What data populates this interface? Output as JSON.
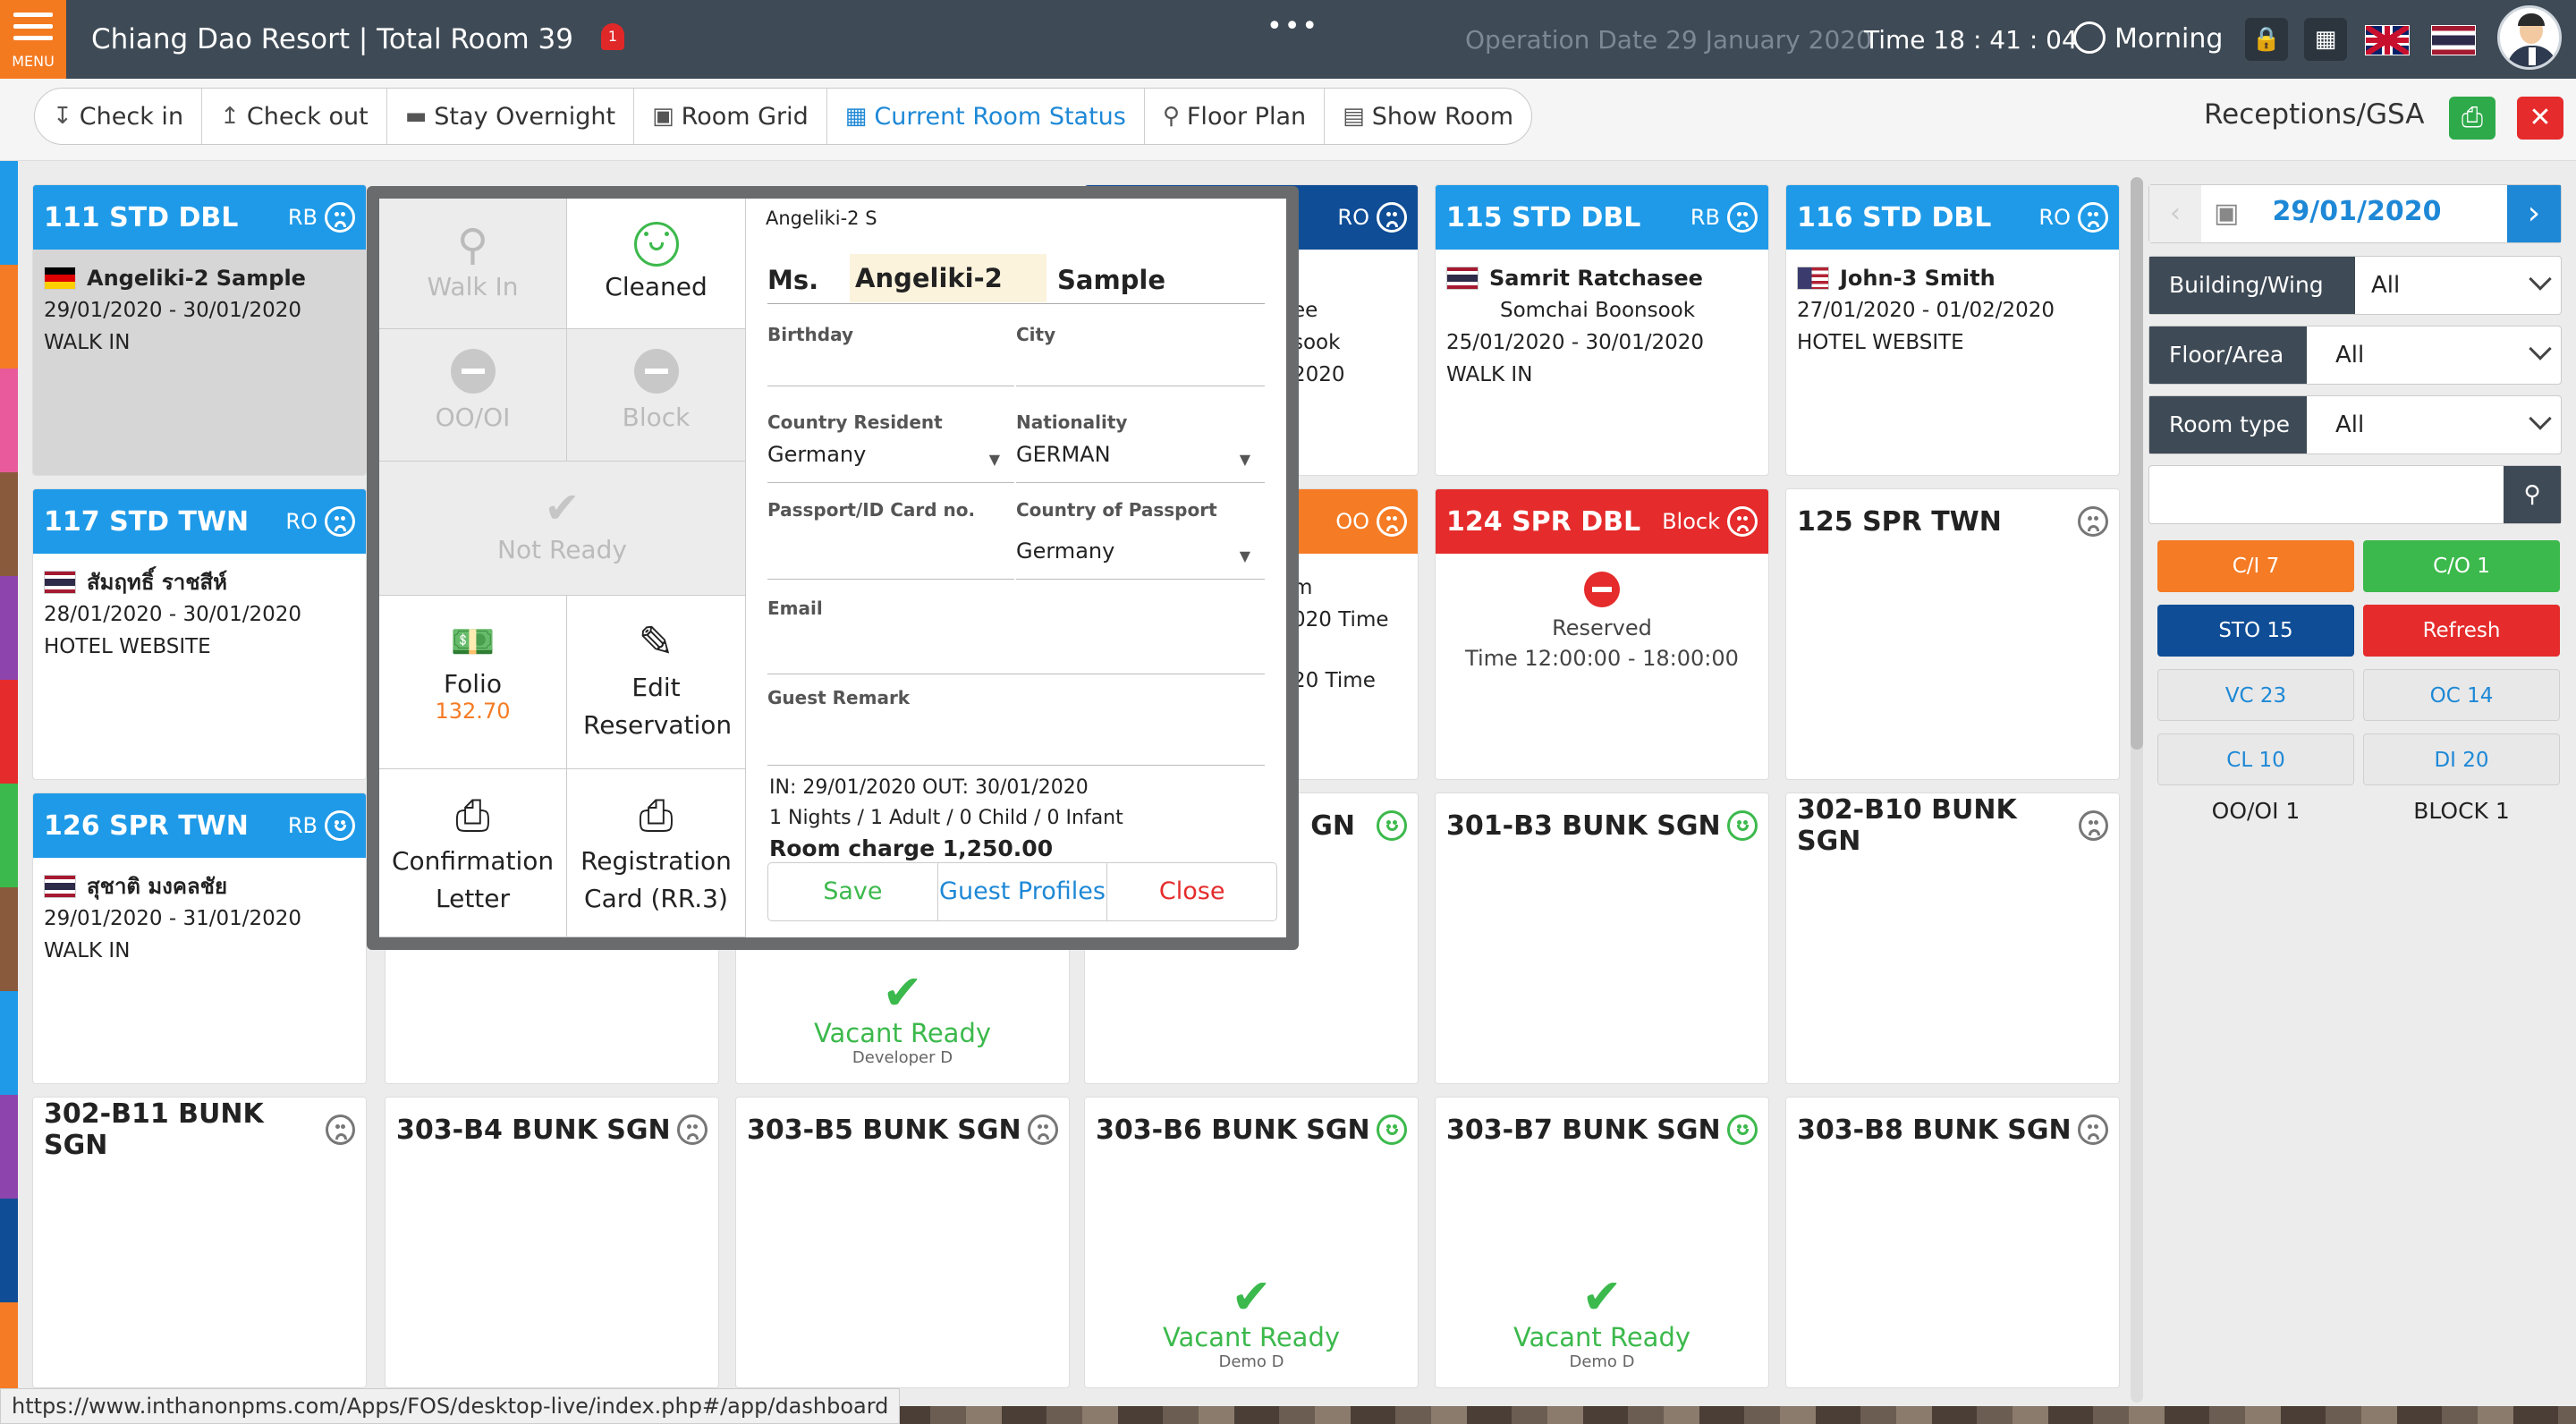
{
  "topbar": {
    "menu_label": "MENU",
    "title": "Chiang Dao Resort | Total Room 39",
    "notification_count": "1",
    "more": "•••",
    "operation_date": "Operation Date 29 January 2020",
    "time": "Time 18 : 41 : 04",
    "shift": "Morning"
  },
  "nav": {
    "tabs": [
      "Check in",
      "Check out",
      "Stay Overnight",
      "Room Grid",
      "Current Room Status",
      "Floor Plan",
      "Show Room"
    ],
    "active_tab": "Current Room Status",
    "receptions_title": "Receptions/GSA"
  },
  "rooms": [
    {
      "title": "111 STD DBL",
      "board": "RB",
      "guest": "Angeliki-2 Sample",
      "dates": "29/01/2020 - 30/01/2020",
      "source": "WALK IN"
    },
    {
      "title": "115 STD DBL",
      "board": "RB",
      "guest": "Samrit Ratchasee",
      "guest2": "Somchai Boonsook",
      "dates": "25/01/2020 - 30/01/2020",
      "source": "WALK IN"
    },
    {
      "title": "116 STD DBL",
      "board": "RO",
      "guest": "John-3 Smith",
      "dates": "27/01/2020 - 01/02/2020",
      "source": "HOTEL WEBSITE"
    },
    {
      "title": "117 STD TWN",
      "board": "RO",
      "guest": "สัมฤทธิ์ ราชสีห์",
      "dates": "28/01/2020 - 30/01/2020",
      "source": "HOTEL WEBSITE"
    },
    {
      "title": "124 SPR DBL",
      "board": "Block",
      "reserved": "Reserved",
      "time": "Time 12:00:00 - 18:00:00"
    },
    {
      "title": "125 SPR TWN"
    },
    {
      "title": "126 SPR TWN",
      "board": "RB",
      "guest": "สุชาติ มงคลชัย",
      "dates": "29/01/2020 - 31/01/2020",
      "source": "WALK IN"
    },
    {
      "title": "301-B3 BUNK SGN"
    },
    {
      "title": "302-B10 BUNK SGN"
    },
    {
      "title": "302-B11 BUNK SGN"
    },
    {
      "title": "303-B4 BUNK SGN"
    },
    {
      "title": "303-B5 BUNK SGN"
    },
    {
      "title": "303-B6 BUNK SGN",
      "status": "Vacant Ready",
      "by": "Demo D"
    },
    {
      "title": "303-B7 BUNK SGN",
      "status": "Vacant Ready",
      "by": "Demo D"
    },
    {
      "title": "303-B8 BUNK SGN"
    }
  ],
  "partial": {
    "ro_label": "RO",
    "oo_label": "OO",
    "frag1": "ee",
    "frag2": "sook",
    "frag3": "2020",
    "frag4": "m",
    "frag5": "020 Time",
    "frag6": "20 Time",
    "frag7": "GN",
    "vacant_status": "Vacant Ready",
    "vacant_by": "Developer D"
  },
  "popup": {
    "walk_in": "Walk In",
    "cleaned": "Cleaned",
    "oo_oi": "OO/OI",
    "block": "Block",
    "not_ready": "Not Ready",
    "folio": "Folio",
    "folio_amount": "132.70",
    "edit_reservation": "Edit Reservation",
    "confirmation_letter": "Confirmation Letter",
    "registration_card": "Registration Card (RR.3)",
    "guest_short": "Angeliki-2 S",
    "salutation": "Ms.",
    "first_name": "Angeliki-2",
    "last_name": "Sample",
    "birthday_label": "Birthday",
    "city_label": "City",
    "country_resident_label": "Country Resident",
    "country_resident": "Germany",
    "nationality_label": "Nationality",
    "nationality": "GERMAN",
    "passport_label": "Passport/ID Card no.",
    "country_passport_label": "Country of Passport",
    "country_passport": "Germany",
    "email_label": "Email",
    "remark_label": "Guest Remark",
    "in_out": "IN: 29/01/2020   OUT: 30/01/2020",
    "occupancy": "1 Nights / 1 Adult / 0 Child / 0 Infant",
    "room_charge": "Room charge 1,250.00",
    "save": "Save",
    "guest_profiles": "Guest Profiles",
    "close": "Close"
  },
  "panel": {
    "date": "29/01/2020",
    "building_label": "Building/Wing",
    "building_value": "All",
    "floor_label": "Floor/Area",
    "floor_value": "All",
    "roomtype_label": "Room type",
    "roomtype_value": "All",
    "search_placeholder": "",
    "buttons": [
      "C/I 7",
      "C/O 1",
      "STO 15",
      "Refresh",
      "VC 23",
      "OC 14",
      "CL 10",
      "DI 20"
    ],
    "oo_oi": "OO/OI 1",
    "block": "BLOCK 1"
  },
  "statusbar": "https://www.inthanonpms.com/Apps/FOS/desktop-live/index.php#/app/dashboard",
  "colors": {
    "topbar": "#3e4a55",
    "accent_orange": "#f47a20",
    "blue": "#1e9ae8",
    "dark_blue": "#0f4d96",
    "red": "#e52b2b",
    "green": "#3cb94c"
  }
}
